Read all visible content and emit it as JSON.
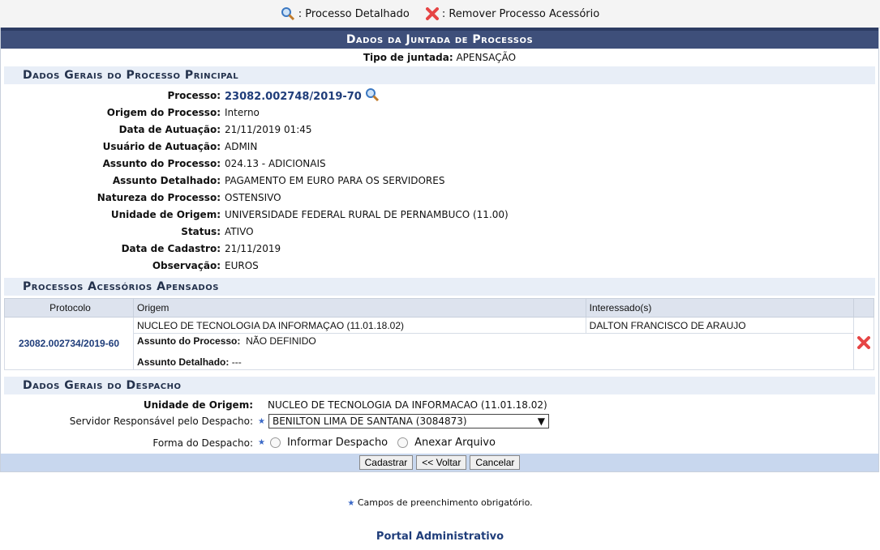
{
  "legend": {
    "view_label": ": Processo Detalhado",
    "remove_label": ": Remover Processo Acessório"
  },
  "main": {
    "title": "Dados da Juntada de Processos",
    "tipo_label": "Tipo de juntada:",
    "tipo_value": "APENSAÇÃO"
  },
  "principal": {
    "section_title": "Dados Gerais do Processo Principal",
    "processo_label": "Processo:",
    "processo_value": "23082.002748/2019-70",
    "fields": [
      {
        "label": "Origem do Processo:",
        "value": "Interno"
      },
      {
        "label": "Data de Autuação:",
        "value": "21/11/2019 01:45"
      },
      {
        "label": "Usuário de Autuação:",
        "value": "ADMIN"
      },
      {
        "label": "Assunto do Processo:",
        "value": "024.13 - ADICIONAIS"
      },
      {
        "label": "Assunto Detalhado:",
        "value": "PAGAMENTO EM EURO PARA OS SERVIDORES"
      },
      {
        "label": "Natureza do Processo:",
        "value": "OSTENSIVO"
      },
      {
        "label": "Unidade de Origem:",
        "value": "UNIVERSIDADE FEDERAL RURAL DE PERNAMBUCO (11.00)"
      },
      {
        "label": "Status:",
        "value": "ATIVO"
      },
      {
        "label": "Data de Cadastro:",
        "value": "21/11/2019"
      },
      {
        "label": "Observação:",
        "value": "EUROS"
      }
    ]
  },
  "acessorios": {
    "section_title": "Processos Acessórios Apensados",
    "headers": {
      "protocolo": "Protocolo",
      "origem": "Origem",
      "interessado": "Interessado(s)"
    },
    "row": {
      "protocolo": "23082.002734/2019-60",
      "origem": "NUCLEO DE TECNOLOGIA DA INFORMAÇAO (11.01.18.02)",
      "interessado": "DALTON FRANCISCO DE ARAUJO",
      "assunto_label": "Assunto do Processo:",
      "assunto_value": "NÃO DEFINIDO",
      "detalhado_label": "Assunto Detalhado:",
      "detalhado_value": "---"
    }
  },
  "despacho": {
    "section_title": "Dados Gerais do Despacho",
    "unidade_label": "Unidade de Origem:",
    "unidade_value": "NUCLEO DE TECNOLOGIA DA INFORMACAO (11.01.18.02)",
    "servidor_label": "Servidor Responsável pelo Despacho:",
    "servidor_value": "BENILTON LIMA DE SANTANA (3084873)",
    "forma_label": "Forma do Despacho:",
    "opt1": "Informar Despacho",
    "opt2": "Anexar Arquivo"
  },
  "actions": {
    "cadastrar": "Cadastrar",
    "voltar": "<< Voltar",
    "cancelar": "Cancelar"
  },
  "footnote": "Campos de preenchimento obrigatório.",
  "portal": "Portal Administrativo",
  "colors": {
    "header": "#3e4f7a",
    "section": "#e8eef7",
    "link": "#1f3d7a",
    "remove": "#e64545"
  }
}
